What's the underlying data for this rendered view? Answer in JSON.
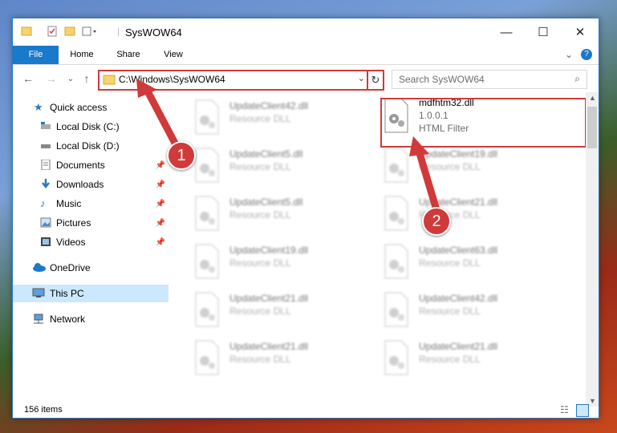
{
  "window": {
    "title": "SysWOW64",
    "controls": {
      "minimize": "—",
      "maximize": "☐",
      "close": "✕"
    }
  },
  "ribbon": {
    "tabs": [
      "File",
      "Home",
      "Share",
      "View"
    ]
  },
  "address": {
    "path": "C:\\Windows\\SysWOW64",
    "search_placeholder": "Search SysWOW64"
  },
  "nav": {
    "quick_access": "Quick access",
    "items": [
      "Local Disk (C:)",
      "Local Disk (D:)",
      "Documents",
      "Downloads",
      "Music",
      "Pictures",
      "Videos"
    ],
    "onedrive": "OneDrive",
    "this_pc": "This PC",
    "network": "Network"
  },
  "files": {
    "left": [
      {
        "name": "UpdateClient42.dll",
        "type": "Resource DLL"
      },
      {
        "name": "UpdateClient5.dll",
        "type": "Resource DLL"
      },
      {
        "name": "UpdateClient5.dll",
        "type": "Resource DLL"
      },
      {
        "name": "UpdateClient19.dll",
        "type": "Resource DLL"
      },
      {
        "name": "UpdateClient21.dll",
        "type": "Resource DLL"
      },
      {
        "name": "UpdateClient21.dll",
        "type": "Resource DLL"
      }
    ],
    "highlighted": {
      "name": "mdfhtm32.dll",
      "version": "1.0.0.1",
      "type": "HTML Filter"
    },
    "right": [
      {
        "name": "UpdateClient19.dll",
        "type": "Resource DLL"
      },
      {
        "name": "UpdateClient21.dll",
        "type": "Resource DLL"
      },
      {
        "name": "UpdateClient63.dll",
        "type": "Resource DLL"
      },
      {
        "name": "UpdateClient42.dll",
        "type": "Resource DLL"
      },
      {
        "name": "UpdateClient21.dll",
        "type": "Resource DLL"
      }
    ]
  },
  "status": {
    "count": "156 items"
  },
  "callouts": {
    "one": "1",
    "two": "2"
  },
  "colors": {
    "accent": "#1979ca",
    "highlight": "#d03a3a"
  }
}
